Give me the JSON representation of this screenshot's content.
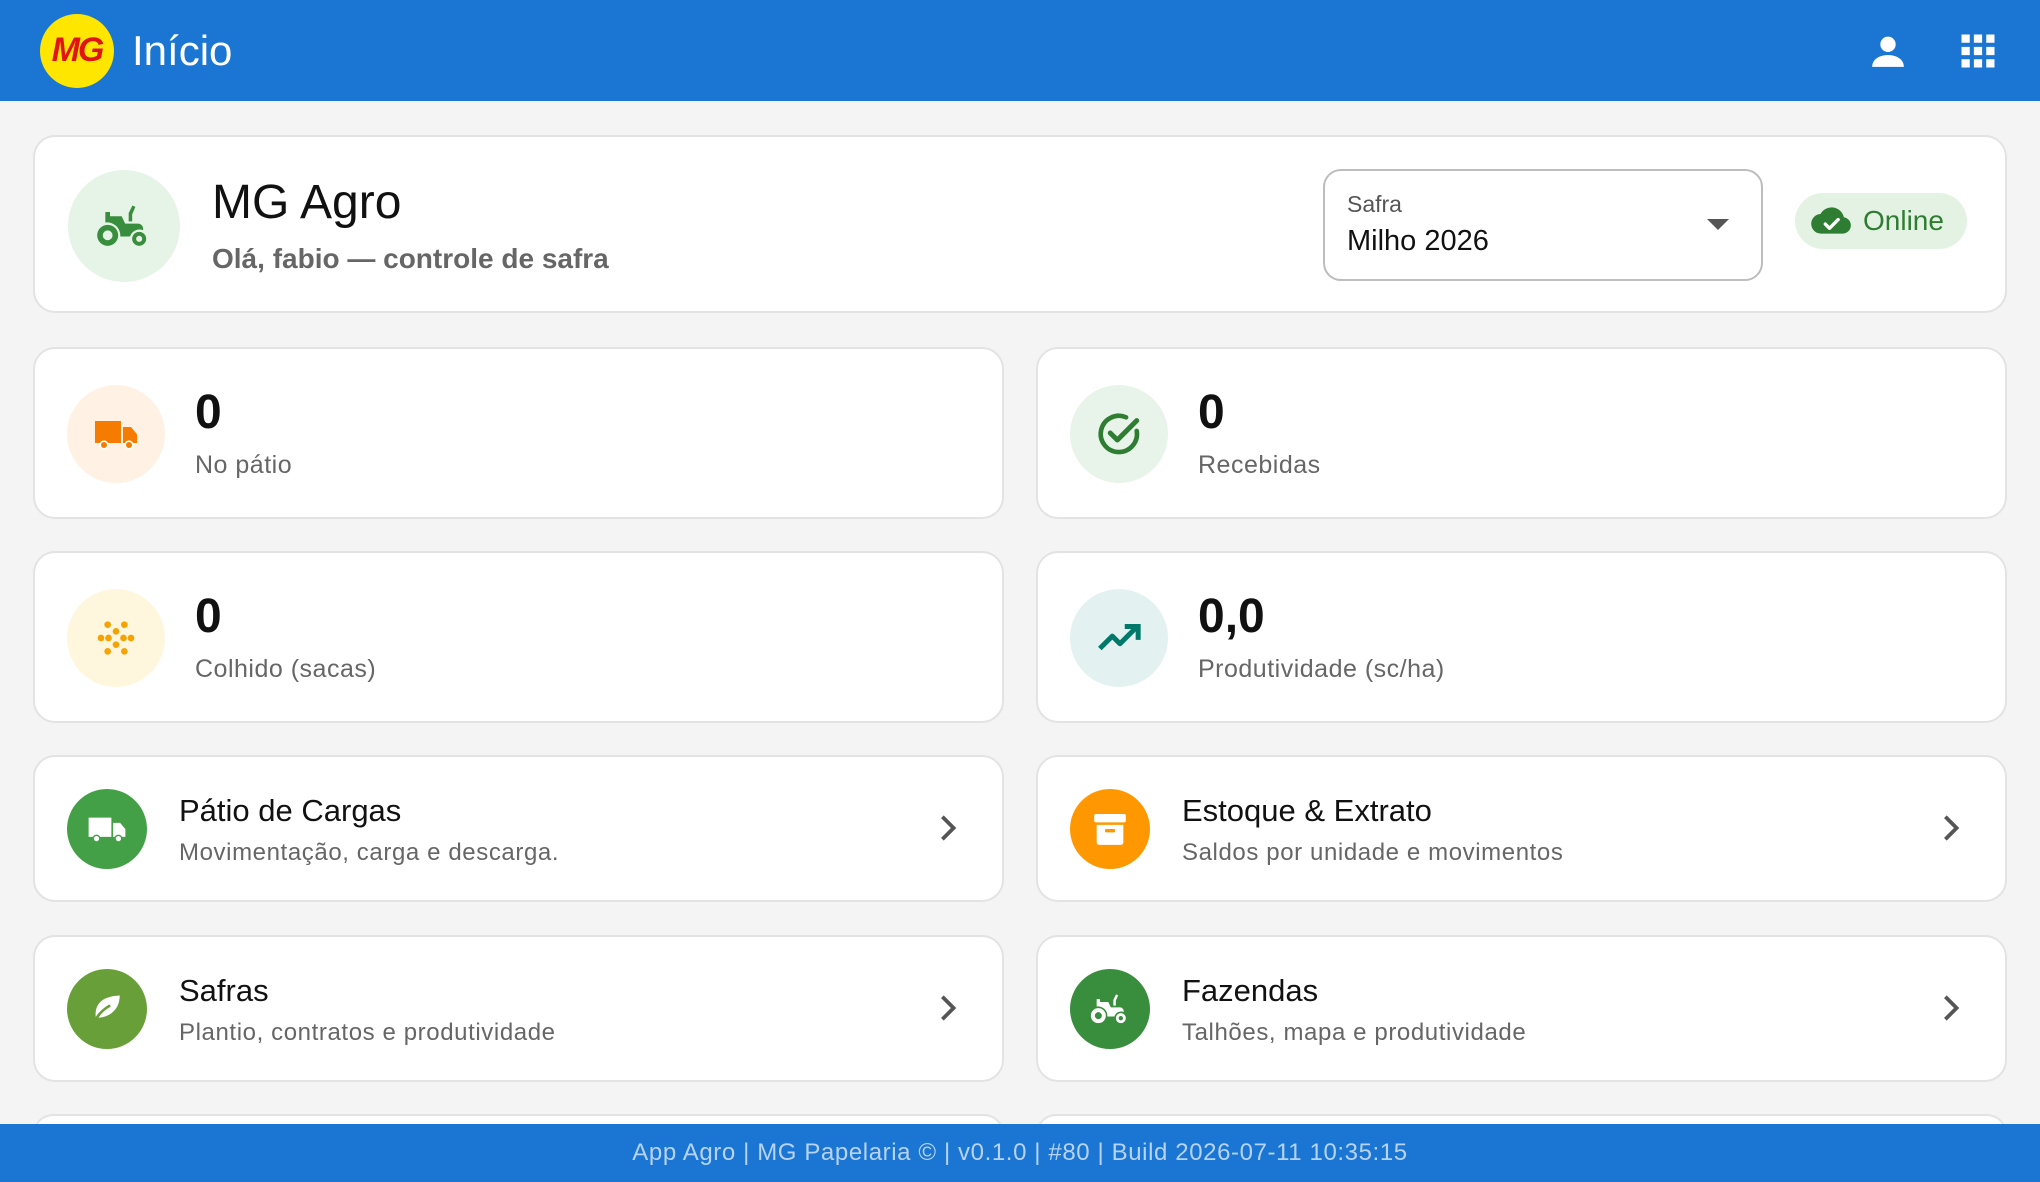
{
  "appbar": {
    "logo_text": "MG",
    "title": "Início",
    "icons": [
      "account-icon",
      "apps-grid-icon"
    ]
  },
  "header": {
    "org_name": "MG Agro",
    "greeting": "Olá, fabio — controle de safra",
    "safra_label": "Safra",
    "safra_value": "Milho 2026",
    "status": "Online"
  },
  "stats": [
    {
      "value": "0",
      "label": "No pátio",
      "icon": "truck-icon",
      "color": "#f57c00",
      "bg": "#fff1e4"
    },
    {
      "value": "0",
      "label": "Recebidas",
      "icon": "check-circle-icon",
      "color": "#2e7d32",
      "bg": "#e8f4e9"
    },
    {
      "value": "0",
      "label": "Colhido (sacas)",
      "icon": "grain-icon",
      "color": "#f5a300",
      "bg": "#fff6de"
    },
    {
      "value": "0,0",
      "label": "Produtividade (sc/ha)",
      "icon": "trending-up-icon",
      "color": "#00796b",
      "bg": "#e3f2f1"
    }
  ],
  "nav": [
    {
      "title": "Pátio de Cargas",
      "subtitle": "Movimentação, carga e descarga.",
      "icon": "truck-icon",
      "color": "#43a047"
    },
    {
      "title": "Estoque & Extrato",
      "subtitle": "Saldos por unidade e movimentos",
      "icon": "archive-icon",
      "color": "#ff9800"
    },
    {
      "title": "Safras",
      "subtitle": "Plantio, contratos e produtividade",
      "icon": "leaf-icon",
      "color": "#689f38"
    },
    {
      "title": "Fazendas",
      "subtitle": "Talhões, mapa e produtividade",
      "icon": "tractor-icon",
      "color": "#388e3c"
    }
  ],
  "footer": {
    "text": "App Agro | MG Papelaria © | v0.1.0 | #80 | Build 2026-07-11 10:35:15"
  }
}
